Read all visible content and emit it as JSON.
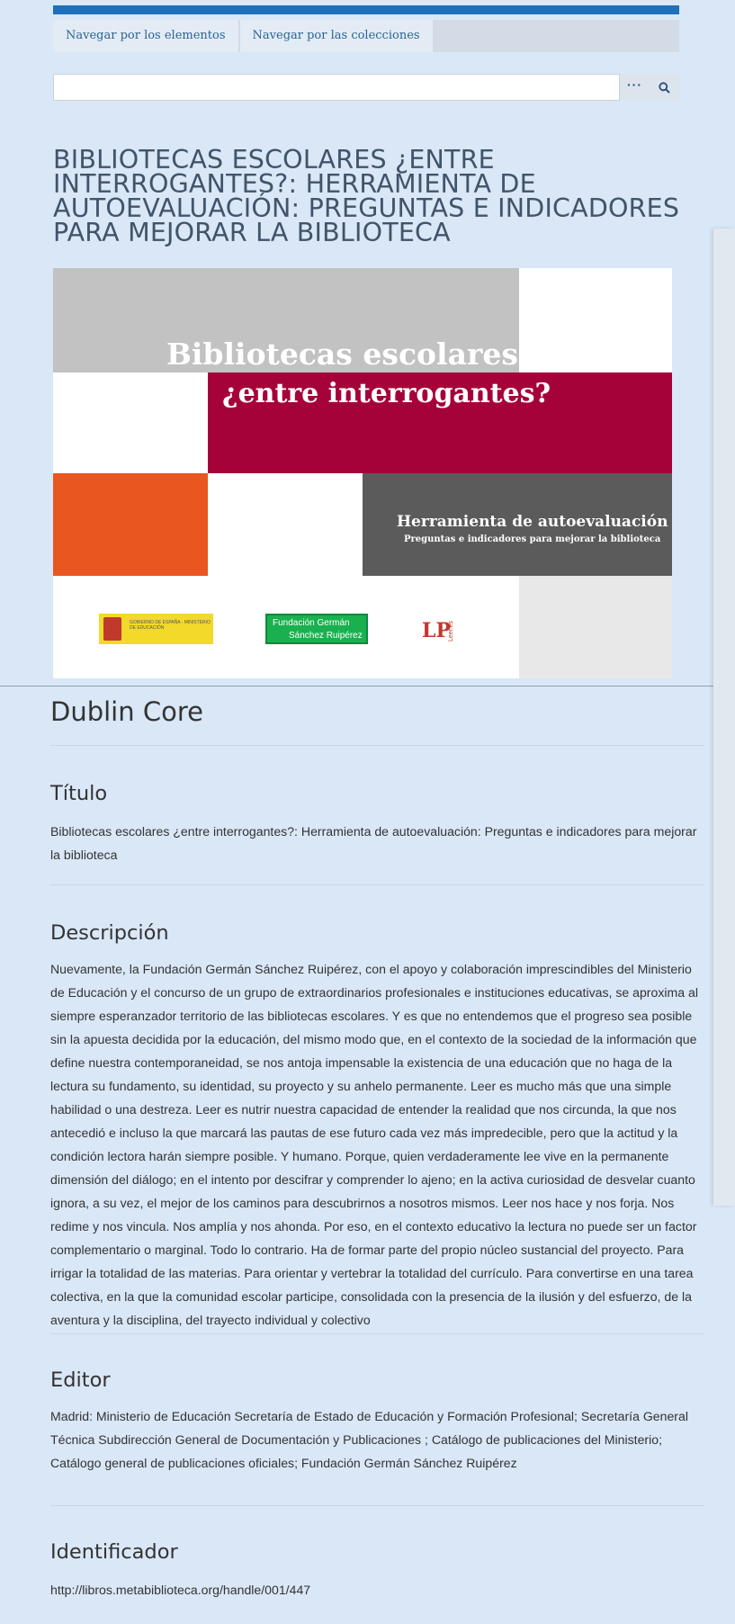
{
  "nav": {
    "items": [
      {
        "label": "Navegar por los elementos"
      },
      {
        "label": "Navegar por las colecciones"
      }
    ]
  },
  "search": {
    "placeholder": "",
    "options_icon": "ellipsis-icon",
    "submit_icon": "search-icon"
  },
  "item": {
    "title": "BIBLIOTECAS ESCOLARES ¿ENTRE INTERROGANTES?: HERRAMIENTA DE AUTOEVALUACIÓN: PREGUNTAS E INDICADORES PARA MEJORAR LA BIBLIOTECA",
    "cover": {
      "line1": "Bibliotecas escolares",
      "line2": "¿entre interrogantes?",
      "line3": "Herramienta de autoevaluación",
      "line4": "Preguntas e indicadores para mejorar la biblioteca",
      "logo_fgsr_line1": "Fundación Germán",
      "logo_fgsr_line2": "Sánchez Ruipérez",
      "logo_lp": "LP",
      "logo_lp_side": "Leer.es",
      "logo_ministry_text": "GOBIERNO DE ESPAÑA · MINISTERIO DE EDUCACIÓN"
    }
  },
  "dublin_core": {
    "heading": "Dublin Core",
    "fields": [
      {
        "label": "Título",
        "value": "Bibliotecas escolares ¿entre interrogantes?: Herramienta de autoevaluación: Preguntas e indicadores para mejorar la biblioteca"
      },
      {
        "label": "Descripción",
        "value": "Nuevamente, la Fundación Germán Sánchez Ruipérez, con el apoyo y colaboración imprescindibles del Ministerio de Educación y el concurso de un grupo de extraordinarios profesionales e instituciones educativas, se aproxima al siempre esperanzador territorio de las bibliotecas escolares. Y es que no entendemos que el progreso sea posible sin la apuesta decidida por la educación, del mismo modo que, en el contexto de la sociedad de la información que define nuestra contemporaneidad, se nos antoja impensable la existencia de una educación que no haga de la lectura su fundamento, su identidad, su proyecto y su anhelo permanente. Leer es mucho más que una simple habilidad o una destreza. Leer es nutrir nuestra capacidad de entender la realidad que nos circunda, la que nos antecedió e incluso la que marcará las pautas de ese futuro cada vez más impredecible, pero que la actitud y la condición lectora harán siempre posible. Y humano. Porque, quien verdaderamente lee vive en la permanente dimensión del diálogo; en el intento por descifrar y comprender lo ajeno; en la activa curiosidad de desvelar cuanto ignora, a su vez, el mejor de los caminos para descubrirnos a nosotros mismos. Leer nos hace y nos forja. Nos redime y nos vincula. Nos amplía y nos ahonda. Por eso, en el contexto educativo la lectura no puede ser un factor complementario o marginal. Todo lo contrario. Ha de formar parte del propio núcleo sustancial del proyecto. Para irrigar la totalidad de las materias. Para orientar y vertebrar la totalidad del currículo. Para convertirse en una tarea colectiva, en la que la comunidad escolar participe, consolidada con la presencia de la ilusión y del esfuerzo, de la aventura y la disciplina, del trayecto individual y colectivo"
      },
      {
        "label": "Editor",
        "value": "Madrid: Ministerio de Educación Secretaría de Estado de Educación y Formación Profesional; Secretaría General Técnica Subdirección General de Documentación y Publicaciones ; Catálogo de publicaciones del Ministerio; Catálogo general de publicaciones oficiales; Fundación Germán Sánchez Ruipérez"
      },
      {
        "label": "Identificador",
        "value": "http://libros.metabiblioteca.org/handle/001/447"
      }
    ]
  },
  "colors": {
    "background": "#d9e7f7",
    "topbar": "#1f6fba",
    "link": "#2a6496",
    "title": "#41546a",
    "cover_crimson": "#a6023a",
    "cover_orange": "#ea5620"
  }
}
